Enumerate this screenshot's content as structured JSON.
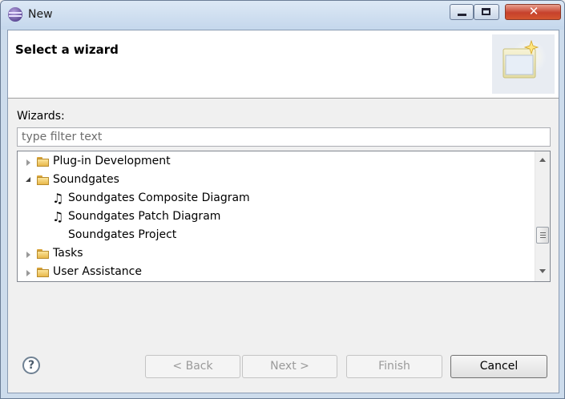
{
  "window": {
    "title": "New",
    "controls": {
      "minimize": "minimize",
      "maximize": "maximize",
      "close": "close"
    }
  },
  "banner": {
    "title": "Select a wizard",
    "icon": "new-wizard-icon"
  },
  "wizards": {
    "label": "Wizards:",
    "filter_placeholder": "type filter text",
    "filter_value": ""
  },
  "tree": {
    "items": [
      {
        "label": "Plug-in Development",
        "type": "folder",
        "state": "collapsed",
        "indent": 0
      },
      {
        "label": "Soundgates",
        "type": "folder",
        "state": "expanded",
        "indent": 0
      },
      {
        "label": "Soundgates Composite Diagram",
        "type": "note",
        "indent": 1
      },
      {
        "label": "Soundgates Patch Diagram",
        "type": "note",
        "indent": 1
      },
      {
        "label": "Soundgates Project",
        "type": "none",
        "indent": 1
      },
      {
        "label": "Tasks",
        "type": "folder",
        "state": "collapsed",
        "indent": 0
      },
      {
        "label": "User Assistance",
        "type": "folder",
        "state": "collapsed",
        "indent": 0
      }
    ]
  },
  "buttons": {
    "help": "?",
    "back": "< Back",
    "next": "Next >",
    "finish": "Finish",
    "cancel": "Cancel"
  },
  "colors": {
    "title_bar": "#c4d7ec",
    "close_button": "#c6412c",
    "folder": "#e8b84a"
  }
}
